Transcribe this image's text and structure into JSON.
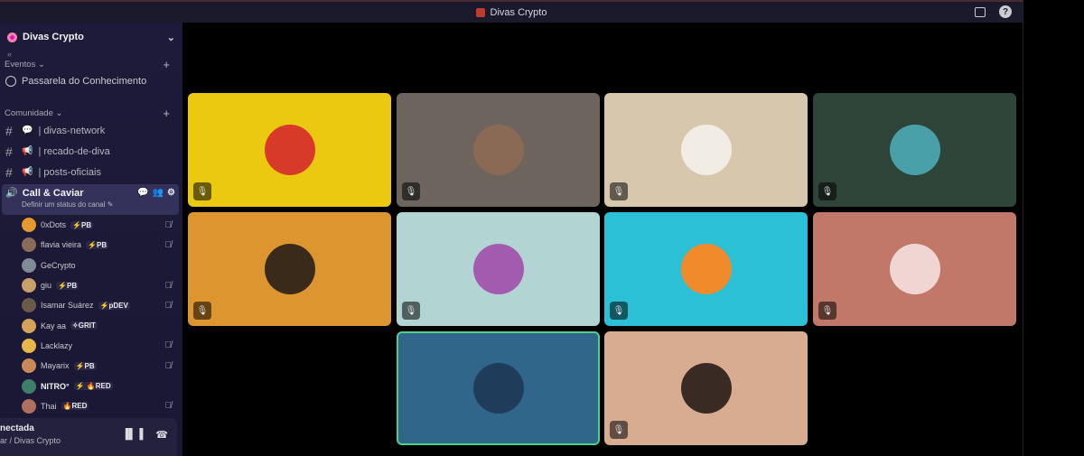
{
  "window": {
    "title": "Divas Crypto"
  },
  "sidebar": {
    "server_name": "Divas Crypto",
    "events_category": "Eventos",
    "event_item": "Passarela do Conhecimento",
    "community_category": "Comunidade",
    "channels": [
      {
        "emoji": "💬",
        "name": "| divas-network"
      },
      {
        "emoji": "📢",
        "name": "| recado-de-diva"
      },
      {
        "emoji": "📢",
        "name": "| posts-oficiais"
      }
    ],
    "voice_channel": {
      "name": "Call & Caviar",
      "status": "Definir um status do canal"
    },
    "members": [
      {
        "name": "0xDots",
        "badge": "⚡PB",
        "color": "#e59a2c"
      },
      {
        "name": "flavia vieira",
        "badge": "⚡PB",
        "color": "#8b6b5a"
      },
      {
        "name": "GeCrypto",
        "badge": "",
        "color": "#7f8b97"
      },
      {
        "name": "giu",
        "badge": "⚡PB",
        "color": "#c9a06a"
      },
      {
        "name": "Isamar Suárez",
        "badge": "⚡pDEV",
        "color": "#6a5a4a"
      },
      {
        "name": "Kay aa",
        "badge": "✧GRIT",
        "color": "#d4a35a"
      },
      {
        "name": "Lacklazy",
        "badge": "",
        "color": "#e6b84a"
      },
      {
        "name": "Mayarix",
        "badge": "⚡PB",
        "color": "#c98a5a"
      },
      {
        "name": "NITRO°",
        "badge": "⚡ 🔥RED",
        "color": "#3f7f6a"
      },
      {
        "name": "Thai",
        "badge": "🔥RED",
        "color": "#b07060"
      }
    ],
    "voice_panel": {
      "status": "nectada",
      "sub": "ar / Divas Crypto"
    }
  },
  "tiles": [
    {
      "bg": "#ebc910",
      "avatar": "#d83a2a"
    },
    {
      "bg": "#6c645d",
      "avatar": "#8a6a55"
    },
    {
      "bg": "#d7c7ad",
      "avatar": "#f1ece4"
    },
    {
      "bg": "#2f4439",
      "avatar": "#4aa0a8"
    },
    {
      "bg": "#dd952f",
      "avatar": "#3a2a1a"
    },
    {
      "bg": "#b2d4d2",
      "avatar": "#a35bb0"
    },
    {
      "bg": "#2bc0d6",
      "avatar": "#f08a2a"
    },
    {
      "bg": "#c27868",
      "avatar": "#f0d6d2"
    },
    {
      "bg": "#30668a",
      "avatar": "#1f3d5a"
    },
    {
      "bg": "#d8ac90",
      "avatar": "#3a2a24"
    }
  ],
  "icons": {
    "topbar": [
      "inbox-icon",
      "help-icon"
    ],
    "tile_mute": "mic-off-icon"
  }
}
